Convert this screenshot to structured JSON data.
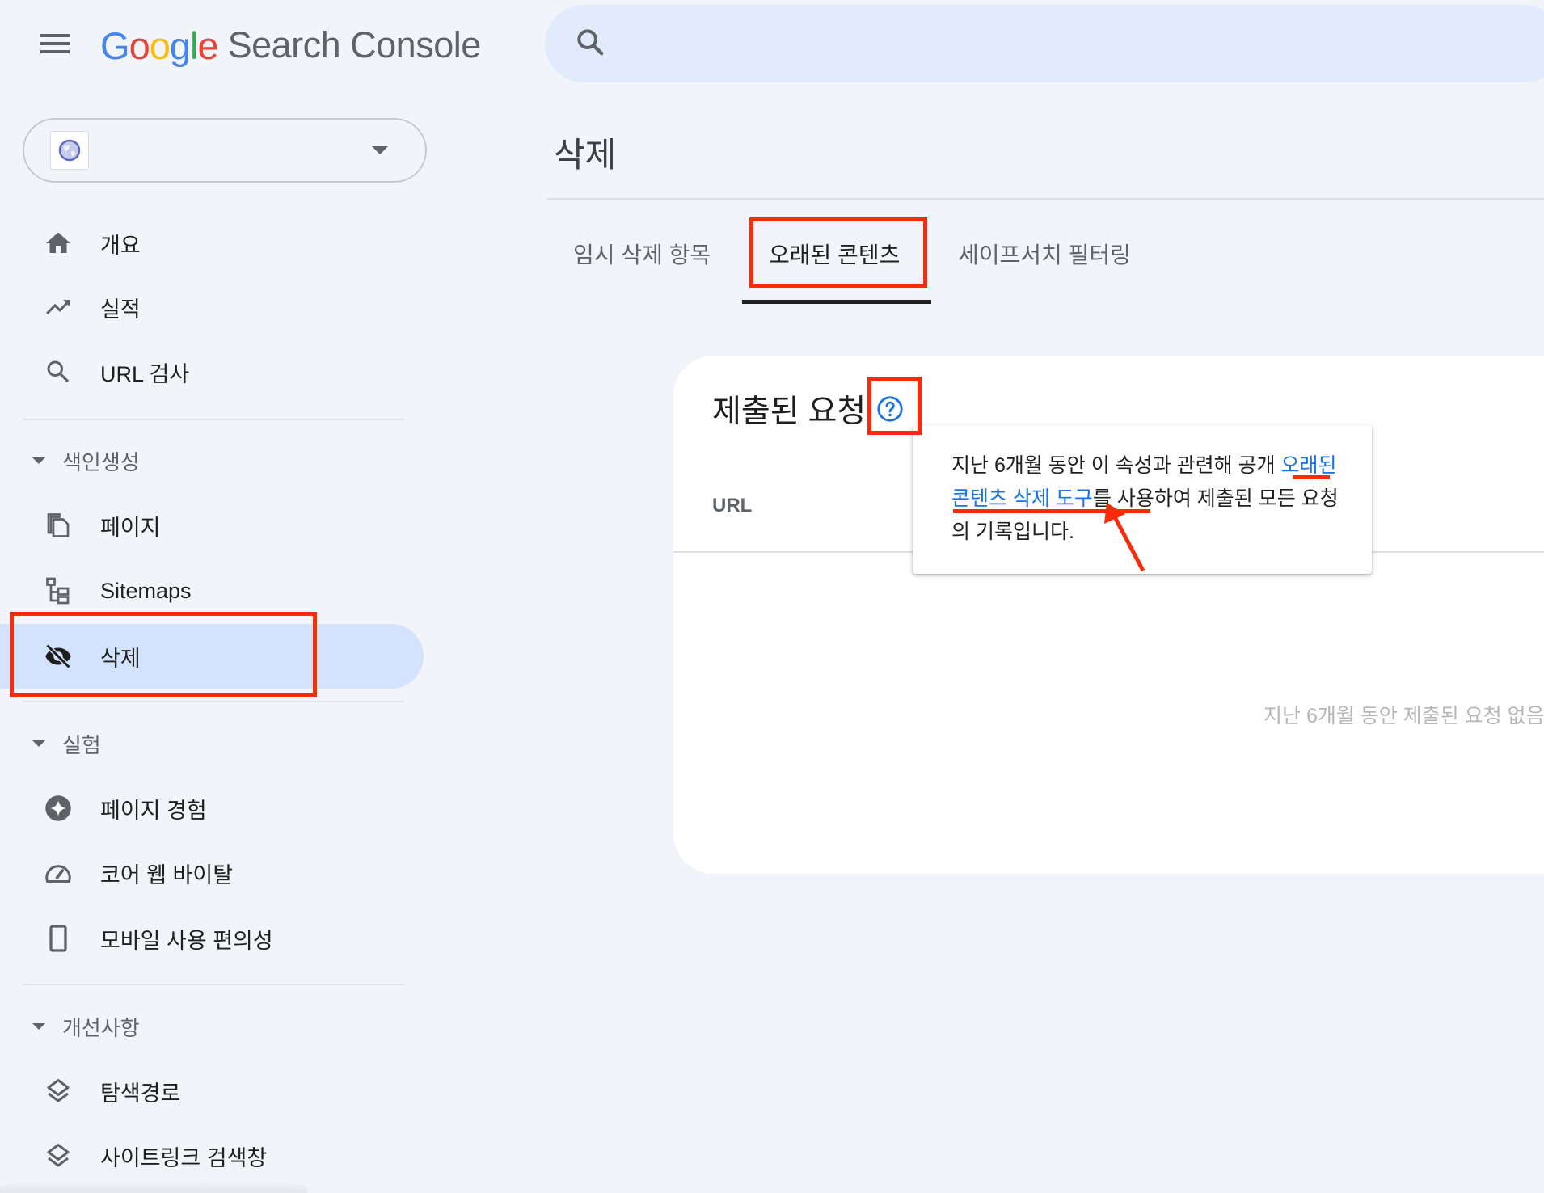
{
  "app": {
    "logo_google": [
      "G",
      "o",
      "o",
      "g",
      "l",
      "e"
    ],
    "logo_colors": [
      "#4285f4",
      "#ea4335",
      "#fbbc05",
      "#4285f4",
      "#34a853",
      "#ea4335"
    ],
    "product_name": "Search Console"
  },
  "search": {
    "icon": "search-icon",
    "placeholder": ""
  },
  "property_selector": {
    "favicon": "globe-icon",
    "value": ""
  },
  "sidebar": {
    "items_top": [
      {
        "label": "개요",
        "icon": "home-icon"
      },
      {
        "label": "실적",
        "icon": "trending-up-icon"
      },
      {
        "label": "URL 검사",
        "icon": "search-icon"
      }
    ],
    "sections": [
      {
        "label": "색인생성",
        "items": [
          {
            "label": "페이지",
            "icon": "pages-icon"
          },
          {
            "label": "Sitemaps",
            "icon": "sitemap-icon"
          },
          {
            "label": "삭제",
            "icon": "eye-off-icon",
            "selected": true
          }
        ]
      },
      {
        "label": "실험",
        "items": [
          {
            "label": "페이지 경험",
            "icon": "sparkle-icon"
          },
          {
            "label": "코어 웹 바이탈",
            "icon": "speedometer-icon"
          },
          {
            "label": "모바일 사용 편의성",
            "icon": "smartphone-icon"
          }
        ]
      },
      {
        "label": "개선사항",
        "items": [
          {
            "label": "탐색경로",
            "icon": "layers-icon"
          },
          {
            "label": "사이트링크 검색창",
            "icon": "layers-icon"
          }
        ]
      }
    ]
  },
  "main": {
    "page_title": "삭제",
    "tabs": [
      {
        "label": "임시 삭제 항목",
        "active": false
      },
      {
        "label": "오래된 콘텐츠",
        "active": true
      },
      {
        "label": "세이프서치 필터링",
        "active": false
      }
    ],
    "card": {
      "title": "제출된 요청",
      "help_icon": "help-circle-icon",
      "columns": [
        "URL"
      ],
      "empty_message": "지난 6개월 동안 제출된 요청 없음"
    },
    "tooltip": {
      "text_before": "지난 6개월 동안 이 속성과 관련해 공개 ",
      "link_text": "오래된 콘텐츠 삭제 도구",
      "text_after": "를 사용하여 제출된 모든 요청의 기록입니다."
    }
  },
  "colors": {
    "accent": "#1a73e8",
    "selected_bg": "#d3e3fd",
    "annotation": "#ff2a0a",
    "background": "#f1f5fa"
  }
}
